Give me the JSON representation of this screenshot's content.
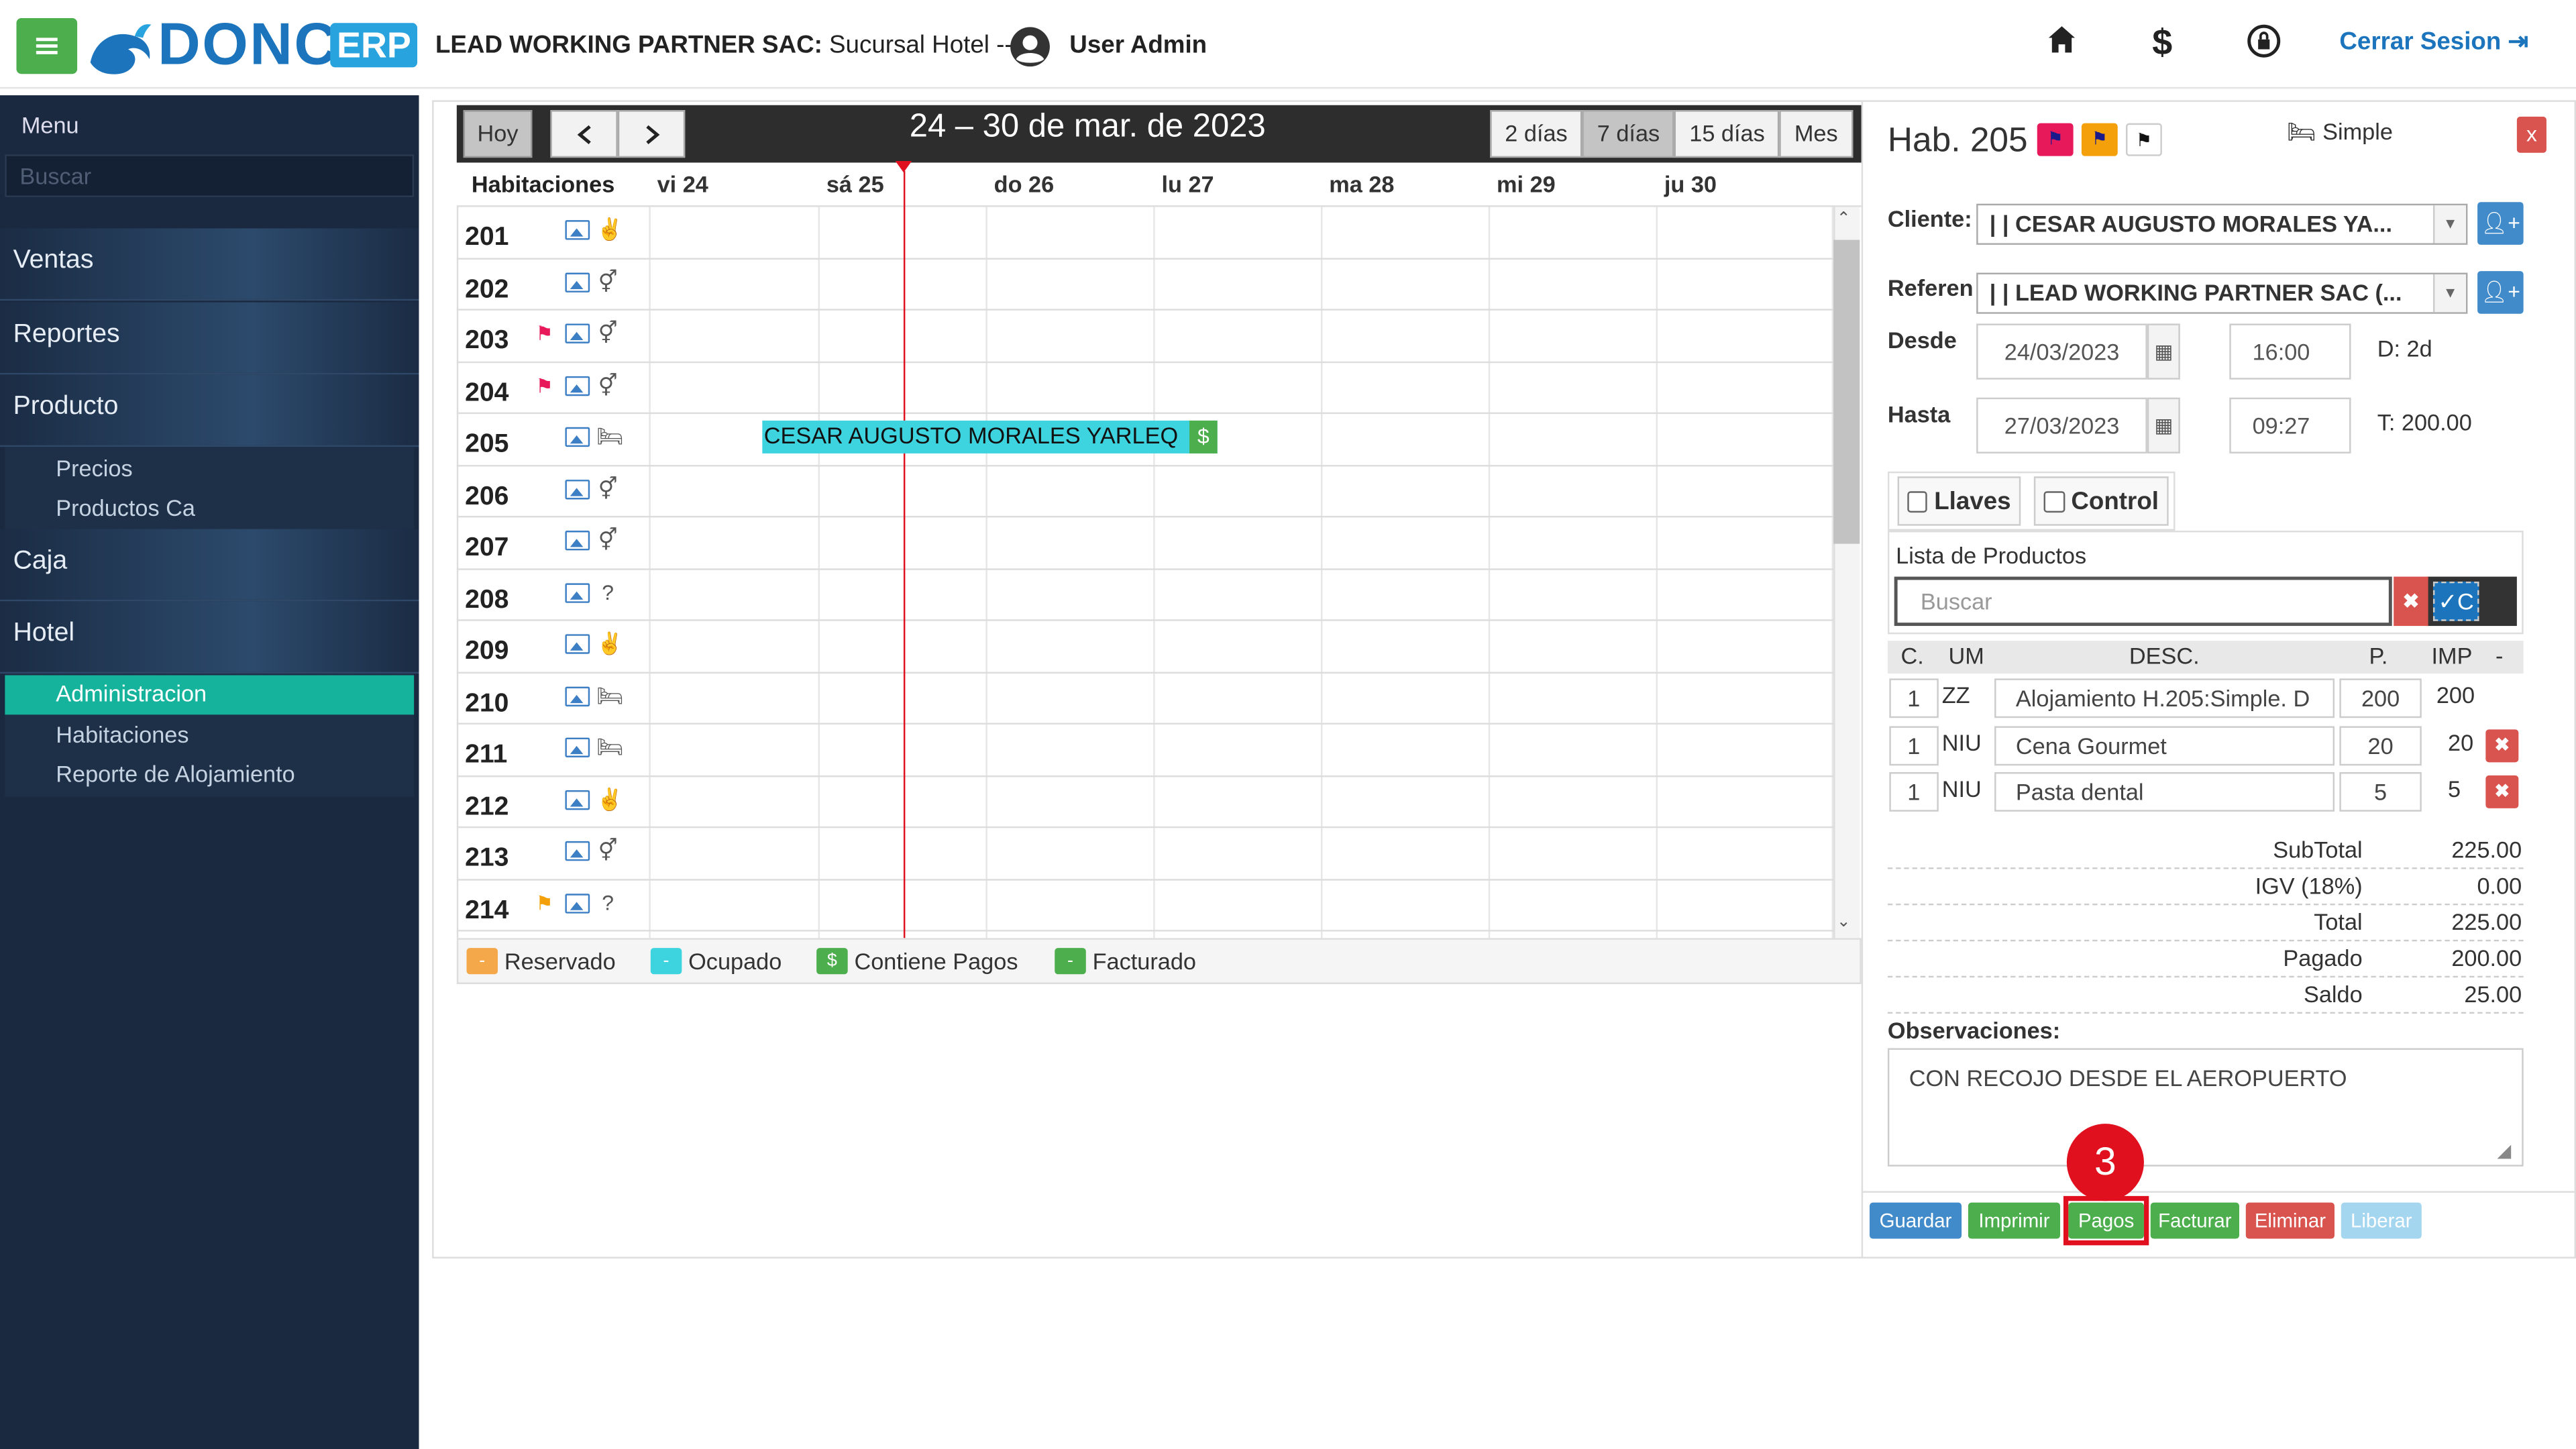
{
  "header": {
    "logo": "DONCA",
    "logo_badge": "ERP",
    "company_name": "LEAD WORKING PARTNER SAC:",
    "branch": " Sucursal Hotel -- |",
    "user": "User Admin",
    "logout": "Cerrar Sesion"
  },
  "sidebar": {
    "title": "Menu",
    "search_placeholder": "Buscar",
    "items": {
      "ventas": "Ventas",
      "reportes": "Reportes",
      "producto": "Producto",
      "precios": "Precios",
      "productos_ca": "Productos Ca",
      "caja": "Caja",
      "hotel": "Hotel",
      "administracion": "Administracion",
      "habitaciones": "Habitaciones",
      "reporte_alojamiento": "Reporte de Alojamiento"
    }
  },
  "calendar": {
    "today_button": "Hoy",
    "prev": "‹",
    "next": "›",
    "title": "24 – 30 de mar. de 2023",
    "views": [
      "2 días",
      "7 días",
      "15 días",
      "Mes"
    ],
    "active_view": "7 días",
    "rooms_header": "Habitaciones",
    "days": [
      "vi 24",
      "sá 25",
      "do 26",
      "lu 27",
      "ma 28",
      "mi 29",
      "ju 30"
    ],
    "rooms": [
      {
        "num": "201",
        "flag": "",
        "type": "peace"
      },
      {
        "num": "202",
        "flag": "",
        "type": "gender"
      },
      {
        "num": "203",
        "flag": "red",
        "type": "gender"
      },
      {
        "num": "204",
        "flag": "red",
        "type": "gender"
      },
      {
        "num": "205",
        "flag": "",
        "type": "bed"
      },
      {
        "num": "206",
        "flag": "",
        "type": "gender"
      },
      {
        "num": "207",
        "flag": "",
        "type": "gender"
      },
      {
        "num": "208",
        "flag": "",
        "type": "question"
      },
      {
        "num": "209",
        "flag": "",
        "type": "peace"
      },
      {
        "num": "210",
        "flag": "",
        "type": "bed"
      },
      {
        "num": "211",
        "flag": "",
        "type": "bed"
      },
      {
        "num": "212",
        "flag": "",
        "type": "peace"
      },
      {
        "num": "213",
        "flag": "",
        "type": "gender"
      },
      {
        "num": "214",
        "flag": "orange",
        "type": "question"
      }
    ],
    "event": {
      "label": "CESAR AUGUSTO MORALES YARLEQ",
      "pay_icon": "$"
    },
    "legend": [
      {
        "label": "Reservado",
        "color": "#f4a84a",
        "mark": "-"
      },
      {
        "label": "Ocupado",
        "color": "#3dd4e0",
        "mark": "-"
      },
      {
        "label": "Contiene Pagos",
        "color": "#4cae4c",
        "mark": "$"
      },
      {
        "label": "Facturado",
        "color": "#4cae4c",
        "mark": "-"
      }
    ]
  },
  "detail": {
    "title": "Hab. 205",
    "room_type": "Simple",
    "close": "x",
    "cliente_label": "Cliente:",
    "cliente_value": "| | CESAR AUGUSTO MORALES YA...",
    "referencia_label": "Referen",
    "referencia_value": "| | LEAD WORKING PARTNER SAC (...",
    "desde_label": "Desde",
    "desde_date": "24/03/2023",
    "desde_time": "16:00",
    "days_info": "D: 2d",
    "hasta_label": "Hasta",
    "hasta_date": "27/03/2023",
    "hasta_time": "09:27",
    "total_info": "T: 200.00",
    "llaves": "Llaves",
    "control": "Control",
    "products_title": "Lista de Productos",
    "products_search_placeholder": "Buscar",
    "products_check_label": "C",
    "table_headers": {
      "c": "C.",
      "um": "UM",
      "desc": "DESC.",
      "p": "P.",
      "imp": "IMP",
      "dash": "-"
    },
    "rows": [
      {
        "c": "1",
        "um": "ZZ",
        "desc": "Alojamiento H.205:Simple. D",
        "p": "200",
        "imp": "200"
      },
      {
        "c": "1",
        "um": "NIU",
        "desc": "Cena Gourmet",
        "p": "20",
        "imp": "20"
      },
      {
        "c": "1",
        "um": "NIU",
        "desc": "Pasta dental",
        "p": "5",
        "imp": "5"
      }
    ],
    "totals": [
      {
        "label": "SubTotal",
        "value": "225.00"
      },
      {
        "label": "IGV (18%)",
        "value": "0.00"
      },
      {
        "label": "Total",
        "value": "225.00"
      },
      {
        "label": "Pagado",
        "value": "200.00"
      },
      {
        "label": "Saldo",
        "value": "25.00"
      }
    ],
    "obs_label": "Observaciones:",
    "obs_value": "CON RECOJO DESDE EL AEROPUERTO",
    "buttons": {
      "guardar": "Guardar",
      "imprimir": "Imprimir",
      "pagos": "Pagos",
      "facturar": "Facturar",
      "eliminar": "Eliminar",
      "liberar": "Liberar"
    },
    "step_badge": "3"
  },
  "colors": {
    "brand": "#1c75bc",
    "sidebar": "#1a2940",
    "active_menu": "#16b39c",
    "event": "#3dd4e0",
    "highlight": "#e0101e"
  }
}
